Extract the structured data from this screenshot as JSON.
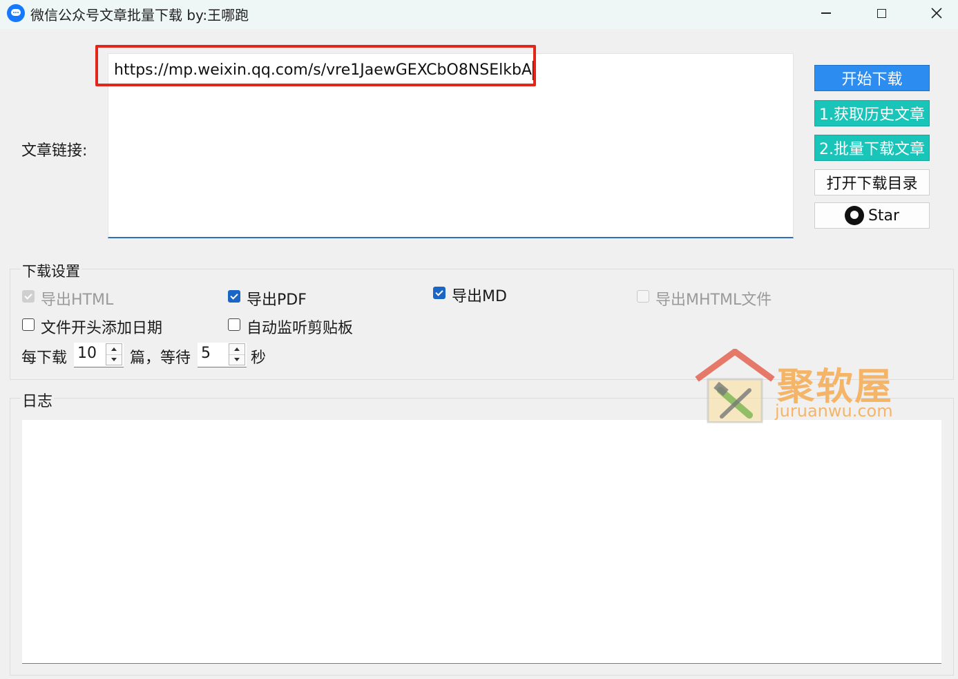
{
  "window": {
    "title": "微信公众号文章批量下载  by:王哪跑",
    "controls": {
      "minimize": "—",
      "maximize": "☐",
      "close": "✕"
    }
  },
  "link_section": {
    "label": "文章链接:",
    "url_value": "https://mp.weixin.qq.com/s/vre1JaewGEXCbO8NSElkbA"
  },
  "buttons": {
    "start": "开始下载",
    "get_history": "1.获取历史文章",
    "batch_download": "2.批量下载文章",
    "open_dir": "打开下载目录",
    "star": "Star"
  },
  "settings": {
    "title": "下载设置",
    "options": [
      {
        "label": "导出HTML",
        "checked": true,
        "disabled": true
      },
      {
        "label": "导出PDF",
        "checked": true,
        "disabled": false
      },
      {
        "label": "导出MD",
        "checked": true,
        "disabled": false
      },
      {
        "label": "导出MHTML文件",
        "checked": false,
        "disabled": true
      },
      {
        "label": "文件开头添加日期",
        "checked": false,
        "disabled": false
      },
      {
        "label": "自动监听剪贴板",
        "checked": false,
        "disabled": false
      }
    ],
    "rate": {
      "prefix": "每下载",
      "count": "10",
      "middle": "篇，等待",
      "seconds": "5",
      "suffix": "秒"
    }
  },
  "log": {
    "title": "日志"
  },
  "watermark": {
    "name": "聚软屋",
    "url": "juruanwu.com"
  },
  "colors": {
    "primary": "#2d8cf0",
    "teal": "#19c4b8",
    "highlight": "#e2261c",
    "checkbox": "#1a66c6"
  }
}
